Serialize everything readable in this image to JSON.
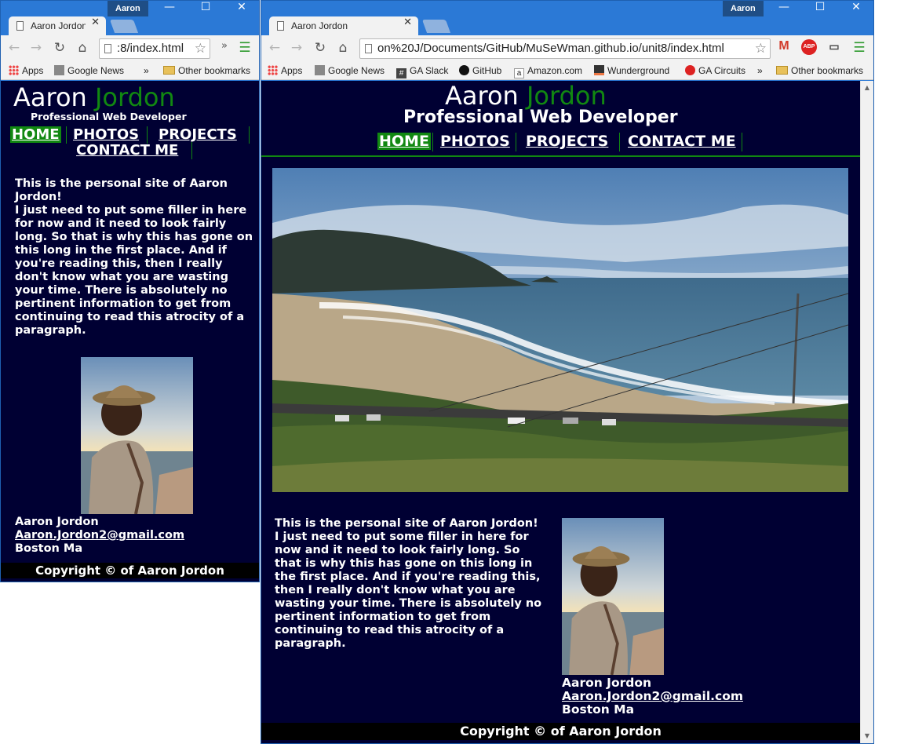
{
  "os": {
    "profile_name": "Aaron",
    "minimize": "—",
    "maximize": "☐",
    "close": "✕"
  },
  "browser": {
    "tab_title": "Aaron Jordon",
    "tab_close": "✕",
    "small_url": ":8/index.html",
    "big_url": "on%20J/Documents/GitHub/MuSeWman.github.io/unit8/index.html",
    "bookmarks_small": [
      {
        "label": "Apps"
      },
      {
        "label": "Google News"
      }
    ],
    "bookmarks_big": [
      {
        "label": "Apps"
      },
      {
        "label": "Google News"
      },
      {
        "label": "GA Slack"
      },
      {
        "label": "GitHub"
      },
      {
        "label": "Amazon.com"
      },
      {
        "label": "Wunderground"
      },
      {
        "label": "GA Circuits"
      }
    ],
    "overflow": "»",
    "other_bookmarks": "Other bookmarks"
  },
  "site": {
    "first_name": "Aaron",
    "last_name": "Jordon",
    "subtitle": "Professional Web Developer",
    "nav": [
      "HOME",
      "PHOTOS",
      "PROJECTS",
      "CONTACT ME"
    ],
    "intro_line": "This is the personal site of Aaron Jordon!",
    "intro_body": "I just need to put some filler in here for now and it need to look fairly long. So that is why this has gone on this long in the first place. And if you're reading this, then I really don't know what you are wasting your time. There is absolutely no pertinent information to get from continuing to read this atrocity of a paragraph.",
    "contact_name": "Aaron Jordon",
    "contact_email": "Aaron.Jordon2@gmail.com",
    "contact_location": "Boston Ma",
    "footer": "Copyright © of Aaron Jordon"
  },
  "colors": {
    "page_bg": "#000033",
    "accent": "#118811",
    "footer_bg": "#000000",
    "chrome_blue": "#2b79d6"
  }
}
